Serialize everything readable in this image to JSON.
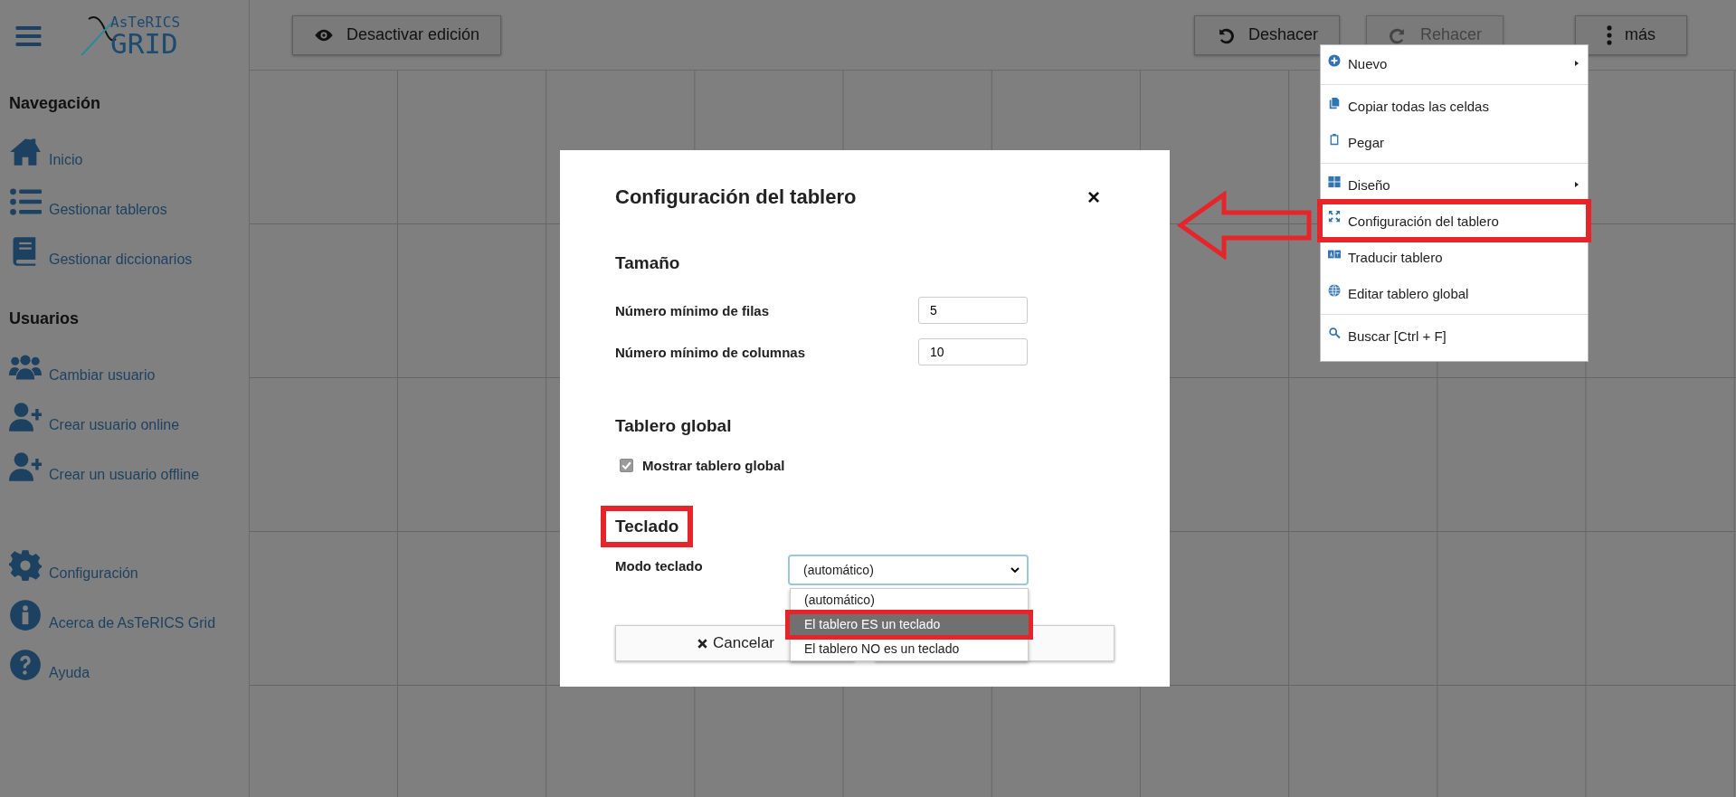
{
  "sidebar": {
    "logo": {
      "line1": "AsTeRICS",
      "line2": "GRID"
    },
    "sections": [
      {
        "title": "Navegación",
        "items": [
          {
            "label": "Inicio"
          },
          {
            "label": "Gestionar tableros"
          },
          {
            "label": "Gestionar diccionarios"
          }
        ]
      },
      {
        "title": "Usuarios",
        "items": [
          {
            "label": "Cambiar usuario"
          },
          {
            "label": "Crear usuario online"
          },
          {
            "label": "Crear un usuario offline"
          }
        ]
      },
      {
        "items": [
          {
            "label": "Configuración"
          },
          {
            "label": "Acerca de AsTeRICS Grid"
          },
          {
            "label": "Ayuda"
          }
        ]
      }
    ]
  },
  "toolbar": {
    "left": [
      {
        "label": "Desactivar edición",
        "disabled": false
      }
    ],
    "right": [
      {
        "label": "Deshacer",
        "disabled": false
      },
      {
        "label": "Rehacer",
        "disabled": true
      },
      {
        "label": "más",
        "disabled": false
      }
    ]
  },
  "menu": {
    "groups": [
      [
        {
          "label": "Nuevo",
          "submenu": true,
          "highlighted": false
        }
      ],
      [
        {
          "label": "Copiar todas las celdas",
          "submenu": false,
          "highlighted": false
        },
        {
          "label": "Pegar",
          "submenu": false,
          "highlighted": false
        }
      ],
      [
        {
          "label": "Diseño",
          "submenu": true,
          "highlighted": false
        },
        {
          "label": "Configuración del tablero",
          "submenu": false,
          "highlighted": true
        },
        {
          "label": "Traducir tablero",
          "submenu": false,
          "highlighted": false
        },
        {
          "label": "Editar tablero global",
          "submenu": false,
          "highlighted": false
        }
      ],
      [
        {
          "label": "Buscar [Ctrl + F]",
          "submenu": false,
          "highlighted": false
        }
      ]
    ]
  },
  "dialog": {
    "title": "Configuración del tablero",
    "close": "×",
    "sections": [
      {
        "heading": "Tamaño",
        "highlighted": false,
        "kind": "number-fields",
        "fields": [
          {
            "label": "Número mínimo de filas",
            "value": "5"
          },
          {
            "label": "Número mínimo de columnas",
            "value": "10"
          }
        ]
      },
      {
        "heading": "Tablero global",
        "highlighted": false,
        "kind": "checkbox",
        "label": "Mostrar tablero global",
        "checked": true
      },
      {
        "heading": "Teclado",
        "highlighted": true,
        "kind": "select",
        "label": "Modo teclado",
        "value": "(automático)",
        "expanded": true,
        "options": [
          {
            "label": "(automático)",
            "hovered": false,
            "highlighted": false
          },
          {
            "label": "El tablero ES un teclado",
            "hovered": true,
            "highlighted": true
          },
          {
            "label": "El tablero NO es un teclado",
            "hovered": false,
            "highlighted": false
          }
        ]
      }
    ],
    "buttons": [
      {
        "label": "Cancelar"
      }
    ]
  }
}
